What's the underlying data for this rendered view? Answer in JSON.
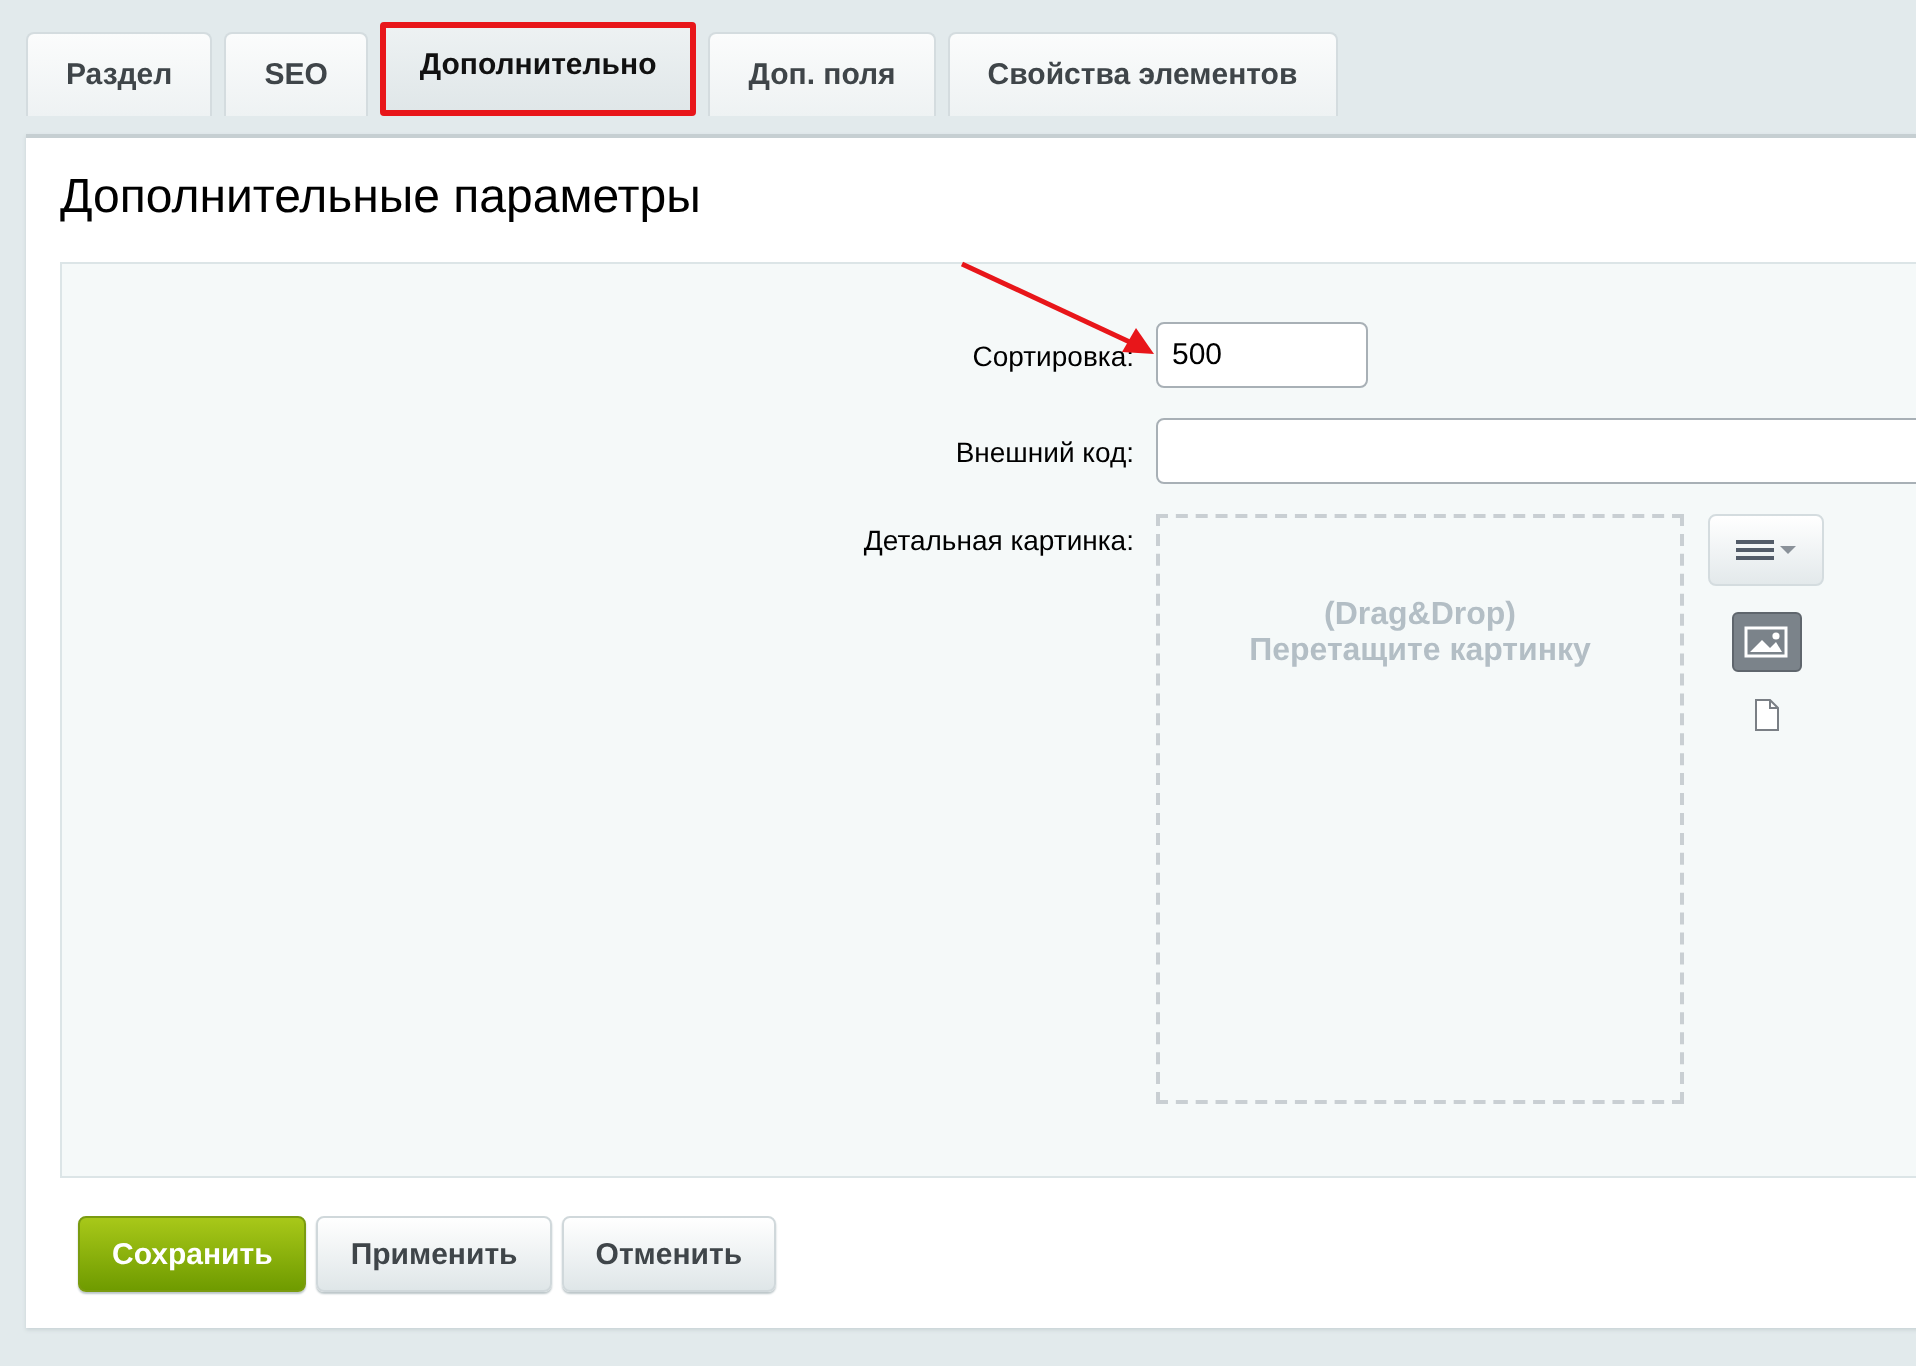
{
  "tabs": [
    {
      "label": "Раздел",
      "selected": false,
      "highlighted": false
    },
    {
      "label": "SEO",
      "selected": false,
      "highlighted": false
    },
    {
      "label": "Дополнительно",
      "selected": true,
      "highlighted": true
    },
    {
      "label": "Доп. поля",
      "selected": false,
      "highlighted": false
    },
    {
      "label": "Свойства элементов",
      "selected": false,
      "highlighted": false
    }
  ],
  "section_title": "Дополнительные параметры",
  "fields": [
    {
      "kind": "short",
      "label": "Сортировка:",
      "value": "500",
      "arrow": true
    },
    {
      "kind": "wide",
      "label": "Внешний код:"
    },
    {
      "kind": "image",
      "label": "Детальная картинка:",
      "hint_line_1": "(Drag&Drop)",
      "hint_line_2": "Перетащите картинку"
    }
  ],
  "buttons": [
    {
      "label": "Сохранить",
      "kind": "primary"
    },
    {
      "label": "Применить",
      "kind": "normal"
    },
    {
      "label": "Отменить",
      "kind": "normal"
    }
  ]
}
